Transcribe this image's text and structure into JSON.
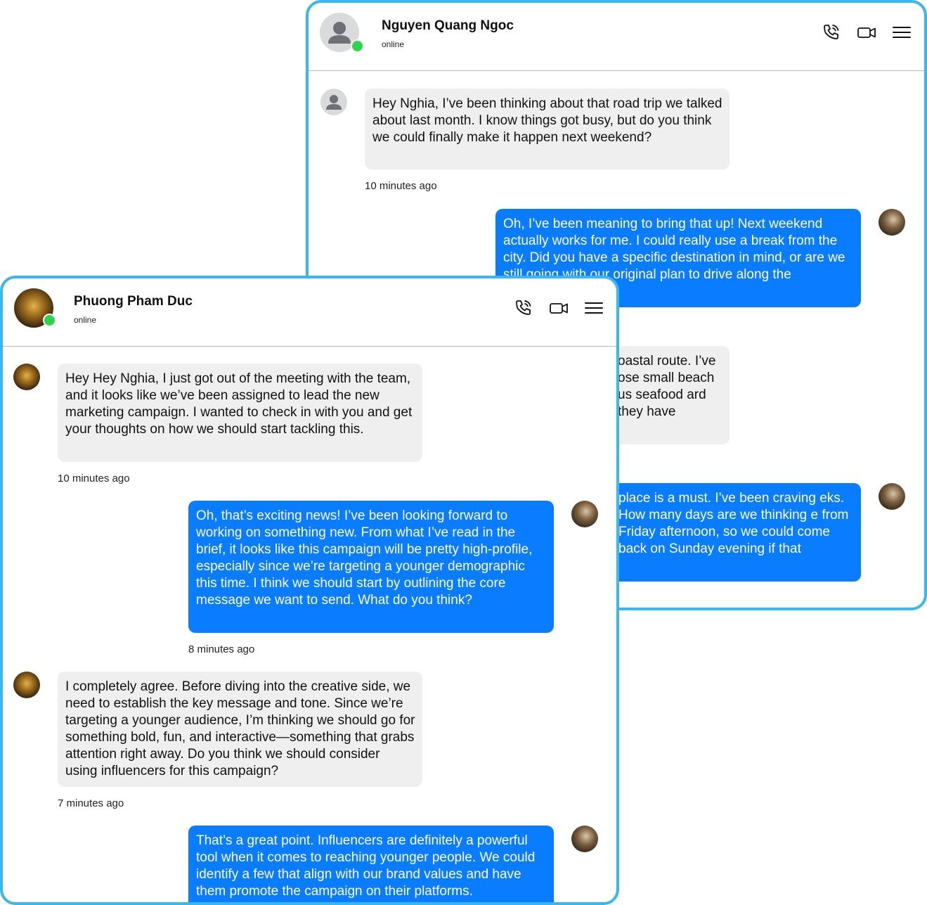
{
  "back_chat": {
    "contact_name": "Nguyen Quang Ngoc",
    "status": "online",
    "messages": [
      {
        "direction": "in",
        "text": "Hey Nghia, I’ve been thinking about that road trip we talked about last month. I know things got busy, but do you think we could finally make it happen next weekend?",
        "time": "10 minutes ago"
      },
      {
        "direction": "out",
        "text": "Oh, I’ve been meaning to bring that up! Next weekend actually works for me. I could really use a break from the city. Did you have a specific destination in mind, or are we still going with our original plan to drive along the"
      },
      {
        "direction": "in",
        "text": "oastal route. I’ve ose small beach us seafood ard they have"
      },
      {
        "direction": "out",
        "text": "place is a must. I’ve been craving eks. How many days are we thinking e from Friday afternoon, so we could come back on Sunday evening if that"
      }
    ]
  },
  "front_chat": {
    "contact_name": "Phuong Pham Duc",
    "status": "online",
    "messages": [
      {
        "direction": "in",
        "text": "Hey Hey Nghia, I just got out of the meeting with the team, and it looks like we’ve been assigned to lead the new marketing campaign. I wanted to check in with you and get your thoughts on how we should start tackling this.",
        "time": "10 minutes ago"
      },
      {
        "direction": "out",
        "text": "Oh, that’s exciting news! I’ve been looking forward to working on something new. From what I’ve read in the brief, it looks like this campaign will be pretty high-profile, especially since we’re targeting a younger demographic this time. I think we should start by outlining the core message we want to send. What do you think?",
        "time": "8 minutes ago"
      },
      {
        "direction": "in",
        "text": "I completely agree. Before diving into the creative side, we need to establish the key message and tone. Since we’re targeting a younger audience, I’m thinking we should go for something bold, fun, and interactive—something that grabs attention right away. Do you think we should consider using influencers for this campaign?",
        "time": "7 minutes ago"
      },
      {
        "direction": "out",
        "text": "That’s a great point. Influencers are definitely a powerful tool when it comes to reaching younger people. We could identify a few that align with our brand values and have them promote the campaign on their platforms."
      }
    ]
  },
  "icons": [
    "phone-icon",
    "video-icon",
    "menu-icon",
    "user-silhouette-icon"
  ],
  "colors": {
    "accent": "#0a7cff",
    "window_border": "#3ab7ee",
    "online": "#2fd44a",
    "incoming_bubble": "#efefef"
  }
}
